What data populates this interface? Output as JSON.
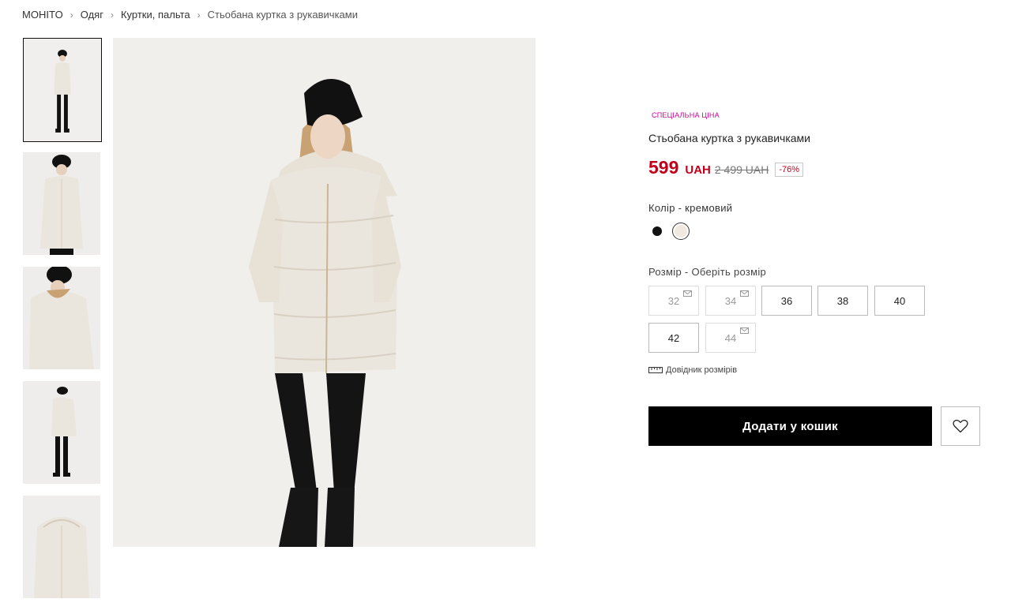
{
  "breadcrumb": {
    "items": [
      "MOHITO",
      "Одяг",
      "Куртки, пальта",
      "Стьобана куртка з рукавичками"
    ]
  },
  "product": {
    "badge": "СПЕЦІАЛЬНА ЦІНА",
    "title": "Стьобана куртка з рукавичками",
    "price": "599",
    "currency": "UAH",
    "old_price": "2 499 UAH",
    "discount": "-76%",
    "color_label": "Колір - кремовий",
    "colors": [
      {
        "name": "black",
        "hex": "#111111"
      },
      {
        "name": "cream",
        "hex": "#efe9e0",
        "selected": true
      }
    ],
    "size_label": "Розмір - Оберіть розмір",
    "sizes": [
      {
        "label": "32",
        "available": false
      },
      {
        "label": "34",
        "available": false
      },
      {
        "label": "36",
        "available": true
      },
      {
        "label": "38",
        "available": true
      },
      {
        "label": "40",
        "available": true
      },
      {
        "label": "42",
        "available": true
      },
      {
        "label": "44",
        "available": false
      }
    ],
    "size_guide": "Довідник розмірів",
    "add_to_cart": "Додати у кошик"
  },
  "colors": {
    "sale": "#c2001a",
    "badge": "#d1009a",
    "button_bg": "#000000"
  }
}
